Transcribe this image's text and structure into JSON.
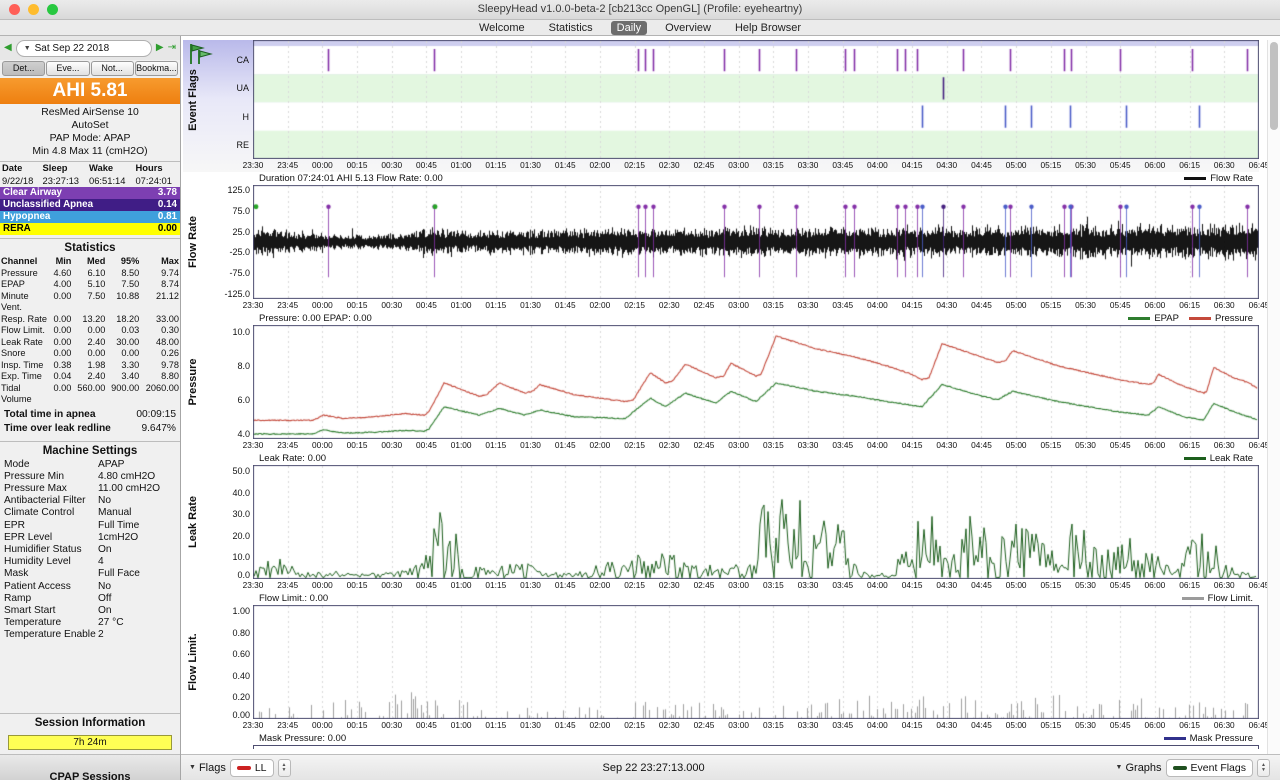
{
  "window": {
    "title": "SleepyHead v1.0.0-beta-2 [cb213cc OpenGL] (Profile: eyeheartny)",
    "tabs": [
      "Welcome",
      "Statistics",
      "Daily",
      "Overview",
      "Help Browser"
    ],
    "active_tab": "Daily"
  },
  "sidebar": {
    "date_label": "Sat Sep 22 2018",
    "tabs": [
      "Det...",
      "Eve...",
      "Not...",
      "Bookma..."
    ],
    "ahi": {
      "label": "AHI",
      "value": "5.81"
    },
    "machine_info": [
      "ResMed AirSense 10",
      "AutoSet",
      "PAP Mode: APAP",
      "Min 4.8 Max 11 (cmH2O)"
    ],
    "session_table": {
      "headers": [
        "Date",
        "Sleep",
        "Wake",
        "Hours"
      ],
      "row": [
        "9/22/18",
        "23:27:13",
        "06:51:14",
        "07:24:01"
      ]
    },
    "event_rows": [
      {
        "label": "Clear Airway",
        "value": "3.78",
        "color": "#7d3fb2",
        "text": "#ffffff"
      },
      {
        "label": "Unclassified Apnea",
        "value": "0.14",
        "color": "#401d86",
        "text": "#ffffff"
      },
      {
        "label": "Hypopnea",
        "value": "0.81",
        "color": "#3fa0dc",
        "text": "#ffffff"
      },
      {
        "label": "RERA",
        "value": "0.00",
        "color": "#ffff00",
        "text": "#000000"
      }
    ],
    "statistics": {
      "title": "Statistics",
      "headers": [
        "Channel",
        "Min",
        "Med",
        "95%",
        "Max"
      ],
      "rows": [
        [
          "Pressure",
          "4.60",
          "6.10",
          "8.50",
          "9.74"
        ],
        [
          "EPAP",
          "4.00",
          "5.10",
          "7.50",
          "8.74"
        ],
        [
          "Minute Vent.",
          "0.00",
          "7.50",
          "10.88",
          "21.12"
        ],
        [
          "Resp. Rate",
          "0.00",
          "13.20",
          "18.20",
          "33.00"
        ],
        [
          "Flow Limit.",
          "0.00",
          "0.00",
          "0.03",
          "0.30"
        ],
        [
          "Leak Rate",
          "0.00",
          "2.40",
          "30.00",
          "48.00"
        ],
        [
          "Snore",
          "0.00",
          "0.00",
          "0.00",
          "0.26"
        ],
        [
          "Insp. Time",
          "0.38",
          "1.98",
          "3.30",
          "9.78"
        ],
        [
          "Exp. Time",
          "0.04",
          "2.40",
          "3.40",
          "8.80"
        ],
        [
          "Tidal Volume",
          "0.00",
          "560.00",
          "900.00",
          "2060.00"
        ]
      ]
    },
    "totals": [
      {
        "label": "Total time in apnea",
        "value": "00:09:15"
      },
      {
        "label": "Time over leak redline",
        "value": "9.647%"
      }
    ],
    "machine_settings": {
      "title": "Machine Settings",
      "rows": [
        [
          "Mode",
          "APAP"
        ],
        [
          "Pressure Min",
          "4.80 cmH2O"
        ],
        [
          "Pressure Max",
          "11.00 cmH2O"
        ],
        [
          "Antibacterial Filter",
          "No"
        ],
        [
          "Climate Control",
          "Manual"
        ],
        [
          "EPR",
          "Full Time"
        ],
        [
          "EPR Level",
          "1cmH2O"
        ],
        [
          "Humidifier Status",
          "On"
        ],
        [
          "Humidity Level",
          "4"
        ],
        [
          "Mask",
          "Full Face"
        ],
        [
          "Patient Access",
          "No"
        ],
        [
          "Ramp",
          "Off"
        ],
        [
          "Smart Start",
          "On"
        ],
        [
          "Temperature",
          "27 °C"
        ],
        [
          "Temperature Enable",
          "2"
        ]
      ]
    },
    "session_info": {
      "title": "Session Information",
      "duration_badge": "7h 24m",
      "footer": "CPAP Sessions"
    }
  },
  "time_ticks": [
    "23:30",
    "23:45",
    "00:00",
    "00:15",
    "00:30",
    "00:45",
    "01:00",
    "01:15",
    "01:30",
    "01:45",
    "02:00",
    "02:15",
    "02:30",
    "02:45",
    "03:00",
    "03:15",
    "03:30",
    "03:45",
    "04:00",
    "04:15",
    "04:30",
    "04:45",
    "05:00",
    "05:15",
    "05:30",
    "05:45",
    "06:00",
    "06:15",
    "06:30",
    "06:45"
  ],
  "graphs": {
    "event_flags": {
      "label": "Event Flags",
      "rows": [
        "CA",
        "UA",
        "H",
        "RE"
      ],
      "colors": {
        "CA": "#8430a8",
        "UA": "#45207f",
        "H": "#4a5cc8",
        "RE": "#b0a000"
      },
      "events": {
        "CA": [
          0.075,
          0.18,
          0.383,
          0.39,
          0.398,
          0.468,
          0.503,
          0.54,
          0.588,
          0.597,
          0.64,
          0.648,
          0.66,
          0.706,
          0.752,
          0.806,
          0.813,
          0.862,
          0.933,
          0.988
        ],
        "UA": [
          0.686
        ],
        "H": [
          0.665,
          0.748,
          0.773,
          0.812,
          0.868,
          0.94
        ],
        "RE": []
      }
    },
    "flow_rate": {
      "label": "Flow Rate",
      "title": "Duration 07:24:01 AHI 5.13 Flow Rate: 0.00",
      "legend": [
        {
          "name": "Flow Rate",
          "color": "#111111"
        }
      ],
      "yticks": [
        [
          125,
          "125.0"
        ],
        [
          75,
          "75.0"
        ],
        [
          25,
          "25.0"
        ],
        [
          -25,
          "-25.0"
        ],
        [
          -75,
          "-75.0"
        ],
        [
          -125,
          "-125.0"
        ]
      ],
      "yrange": [
        -137.5,
        137.5
      ],
      "markers": [
        0.003,
        0.181
      ],
      "envelope": [
        [
          0,
          38
        ],
        [
          0.02,
          42
        ],
        [
          0.04,
          30
        ],
        [
          0.07,
          24
        ],
        [
          0.1,
          22
        ],
        [
          0.13,
          24
        ],
        [
          0.16,
          30
        ],
        [
          0.18,
          40
        ],
        [
          0.21,
          34
        ],
        [
          0.25,
          32
        ],
        [
          0.3,
          36
        ],
        [
          0.35,
          38
        ],
        [
          0.38,
          42
        ],
        [
          0.42,
          38
        ],
        [
          0.46,
          40
        ],
        [
          0.5,
          44
        ],
        [
          0.54,
          40
        ],
        [
          0.58,
          44
        ],
        [
          0.62,
          42
        ],
        [
          0.66,
          46
        ],
        [
          0.7,
          44
        ],
        [
          0.74,
          46
        ],
        [
          0.78,
          44
        ],
        [
          0.82,
          48
        ],
        [
          0.86,
          46
        ],
        [
          0.9,
          48
        ],
        [
          0.94,
          46
        ],
        [
          0.97,
          50
        ],
        [
          1,
          48
        ]
      ]
    },
    "pressure": {
      "label": "Pressure",
      "title": "Pressure: 0.00 EPAP: 0.00",
      "legend": [
        {
          "name": "EPAP",
          "color": "#2e7d2e"
        },
        {
          "name": "Pressure",
          "color": "#c4493b"
        }
      ],
      "yticks": [
        [
          10,
          "10.0"
        ],
        [
          8,
          "8.0"
        ],
        [
          6,
          "6.0"
        ],
        [
          4,
          "4.0"
        ]
      ],
      "yrange": [
        3.7,
        10.4
      ],
      "pressure_points": [
        [
          0,
          4.8
        ],
        [
          0.06,
          4.8
        ],
        [
          0.07,
          5.1
        ],
        [
          0.09,
          4.9
        ],
        [
          0.12,
          5.0
        ],
        [
          0.15,
          5.2
        ],
        [
          0.17,
          5.1
        ],
        [
          0.175,
          5.3
        ],
        [
          0.19,
          7.0
        ],
        [
          0.225,
          6.2
        ],
        [
          0.232,
          6.3
        ],
        [
          0.245,
          7.0
        ],
        [
          0.27,
          6.4
        ],
        [
          0.278,
          6.5
        ],
        [
          0.285,
          6.9
        ],
        [
          0.32,
          6.3
        ],
        [
          0.37,
          5.9
        ],
        [
          0.378,
          6.0
        ],
        [
          0.395,
          7.6
        ],
        [
          0.41,
          7.0
        ],
        [
          0.417,
          7.1
        ],
        [
          0.43,
          8.1
        ],
        [
          0.46,
          7.3
        ],
        [
          0.468,
          7.4
        ],
        [
          0.475,
          8.15
        ],
        [
          0.5,
          7.4
        ],
        [
          0.505,
          7.5
        ],
        [
          0.52,
          9.75
        ],
        [
          0.56,
          9.0
        ],
        [
          0.6,
          8.5
        ],
        [
          0.63,
          8.0
        ],
        [
          0.655,
          7.5
        ],
        [
          0.665,
          7.2
        ],
        [
          0.672,
          7.3
        ],
        [
          0.685,
          9.3
        ],
        [
          0.72,
          8.6
        ],
        [
          0.74,
          8.2
        ],
        [
          0.748,
          8.3
        ],
        [
          0.755,
          8.9
        ],
        [
          0.8,
          8.0
        ],
        [
          0.83,
          7.6
        ],
        [
          0.86,
          7.2
        ],
        [
          0.89,
          6.9
        ],
        [
          0.895,
          7.0
        ],
        [
          0.9,
          7.5
        ],
        [
          0.925,
          6.8
        ],
        [
          0.945,
          6.4
        ],
        [
          0.948,
          6.5
        ],
        [
          0.955,
          7.9
        ],
        [
          0.975,
          7.3
        ],
        [
          0.99,
          7.0
        ],
        [
          1,
          6.6
        ]
      ],
      "epap_points": [
        [
          0,
          4.0
        ],
        [
          0.06,
          4.0
        ],
        [
          0.07,
          4.25
        ],
        [
          0.09,
          4.05
        ],
        [
          0.12,
          4.1
        ],
        [
          0.15,
          4.2
        ],
        [
          0.17,
          4.15
        ],
        [
          0.175,
          4.3
        ],
        [
          0.19,
          5.6
        ],
        [
          0.225,
          5.1
        ],
        [
          0.245,
          5.5
        ],
        [
          0.27,
          5.1
        ],
        [
          0.285,
          5.4
        ],
        [
          0.32,
          5.0
        ],
        [
          0.37,
          4.9
        ],
        [
          0.395,
          6.1
        ],
        [
          0.41,
          5.6
        ],
        [
          0.43,
          6.4
        ],
        [
          0.46,
          5.8
        ],
        [
          0.475,
          6.5
        ],
        [
          0.5,
          5.9
        ],
        [
          0.52,
          7.0
        ],
        [
          0.56,
          6.5
        ],
        [
          0.6,
          6.2
        ],
        [
          0.63,
          5.9
        ],
        [
          0.665,
          5.6
        ],
        [
          0.685,
          6.9
        ],
        [
          0.72,
          6.3
        ],
        [
          0.74,
          6.0
        ],
        [
          0.755,
          6.5
        ],
        [
          0.8,
          5.9
        ],
        [
          0.83,
          5.6
        ],
        [
          0.86,
          5.3
        ],
        [
          0.89,
          5.1
        ],
        [
          0.9,
          5.6
        ],
        [
          0.925,
          5.0
        ],
        [
          0.945,
          4.8
        ],
        [
          0.955,
          5.8
        ],
        [
          0.975,
          5.3
        ],
        [
          0.99,
          5.0
        ],
        [
          1,
          4.8
        ]
      ]
    },
    "leak_rate": {
      "label": "Leak Rate",
      "title": "Leak Rate: 0.00",
      "legend": [
        {
          "name": "Leak Rate",
          "color": "#1d5f1d"
        }
      ],
      "yticks": [
        [
          50,
          "50.0"
        ],
        [
          40,
          "40.0"
        ],
        [
          30,
          "30.0"
        ],
        [
          20,
          "20.0"
        ],
        [
          10,
          "10.0"
        ],
        [
          0,
          "0.0"
        ]
      ],
      "yrange": [
        0,
        53
      ],
      "envelope": [
        [
          0,
          5
        ],
        [
          0.015,
          9
        ],
        [
          0.03,
          10
        ],
        [
          0.045,
          4
        ],
        [
          0.08,
          5
        ],
        [
          0.11,
          3
        ],
        [
          0.14,
          4
        ],
        [
          0.165,
          8
        ],
        [
          0.172,
          26
        ],
        [
          0.185,
          34
        ],
        [
          0.2,
          28
        ],
        [
          0.21,
          8
        ],
        [
          0.24,
          5
        ],
        [
          0.265,
          9
        ],
        [
          0.29,
          4
        ],
        [
          0.33,
          5
        ],
        [
          0.36,
          9
        ],
        [
          0.38,
          11
        ],
        [
          0.41,
          13
        ],
        [
          0.435,
          7
        ],
        [
          0.46,
          6
        ],
        [
          0.49,
          8
        ],
        [
          0.5,
          10
        ],
        [
          0.507,
          38
        ],
        [
          0.515,
          46
        ],
        [
          0.53,
          44
        ],
        [
          0.545,
          40
        ],
        [
          0.553,
          20
        ],
        [
          0.56,
          38
        ],
        [
          0.575,
          42
        ],
        [
          0.585,
          30
        ],
        [
          0.592,
          10
        ],
        [
          0.61,
          4
        ],
        [
          0.635,
          3
        ],
        [
          0.65,
          20
        ],
        [
          0.66,
          28
        ],
        [
          0.675,
          30
        ],
        [
          0.688,
          26
        ],
        [
          0.698,
          12
        ],
        [
          0.708,
          28
        ],
        [
          0.722,
          32
        ],
        [
          0.735,
          14
        ],
        [
          0.745,
          24
        ],
        [
          0.76,
          28
        ],
        [
          0.775,
          22
        ],
        [
          0.79,
          18
        ],
        [
          0.805,
          26
        ],
        [
          0.822,
          28
        ],
        [
          0.84,
          14
        ],
        [
          0.855,
          20
        ],
        [
          0.87,
          22
        ],
        [
          0.885,
          18
        ],
        [
          0.9,
          10
        ],
        [
          0.915,
          6
        ],
        [
          0.928,
          18
        ],
        [
          0.94,
          24
        ],
        [
          0.952,
          22
        ],
        [
          0.963,
          10
        ],
        [
          0.975,
          6
        ],
        [
          0.99,
          4
        ],
        [
          1,
          3
        ]
      ]
    },
    "flow_limit": {
      "label": "Flow Limit.",
      "title": "Flow Limit.: 0.00",
      "legend": [
        {
          "name": "Flow Limit.",
          "color": "#9b9b9b"
        }
      ],
      "yticks": [
        [
          1,
          "1.00"
        ],
        [
          0.8,
          "0.80"
        ],
        [
          0.6,
          "0.60"
        ],
        [
          0.4,
          "0.40"
        ],
        [
          0.2,
          "0.20"
        ],
        [
          0,
          "0.00"
        ]
      ],
      "yrange": [
        0,
        1.06
      ],
      "density": [
        [
          0,
          0.22
        ],
        [
          0.08,
          0.28
        ],
        [
          0.15,
          0.45
        ],
        [
          0.18,
          0.5
        ],
        [
          0.22,
          0.3
        ],
        [
          0.3,
          0.3
        ],
        [
          0.38,
          0.45
        ],
        [
          0.45,
          0.4
        ],
        [
          0.52,
          0.45
        ],
        [
          0.6,
          0.5
        ],
        [
          0.68,
          0.55
        ],
        [
          0.75,
          0.5
        ],
        [
          0.82,
          0.5
        ],
        [
          0.9,
          0.45
        ],
        [
          1,
          0.3
        ]
      ],
      "peak": [
        [
          0,
          0.14
        ],
        [
          0.12,
          0.18
        ],
        [
          0.17,
          0.32
        ],
        [
          0.22,
          0.16
        ],
        [
          0.3,
          0.14
        ],
        [
          0.4,
          0.2
        ],
        [
          0.5,
          0.18
        ],
        [
          0.6,
          0.2
        ],
        [
          0.66,
          0.28
        ],
        [
          0.72,
          0.2
        ],
        [
          0.8,
          0.22
        ],
        [
          0.88,
          0.2
        ],
        [
          1,
          0.14
        ]
      ]
    },
    "mask_pressure": {
      "title": "Mask Pressure: 0.00",
      "legend": [
        {
          "name": "Mask Pressure",
          "color": "#31318c"
        }
      ]
    }
  },
  "bottom_bar": {
    "flags_label": "Flags",
    "flags_value": "LL",
    "flags_color": "#cc2222",
    "center_text": "Sep 22 23:27:13.000",
    "graphs_label": "Graphs",
    "graphs_value": "Event Flags",
    "graphs_color": "#205020"
  }
}
